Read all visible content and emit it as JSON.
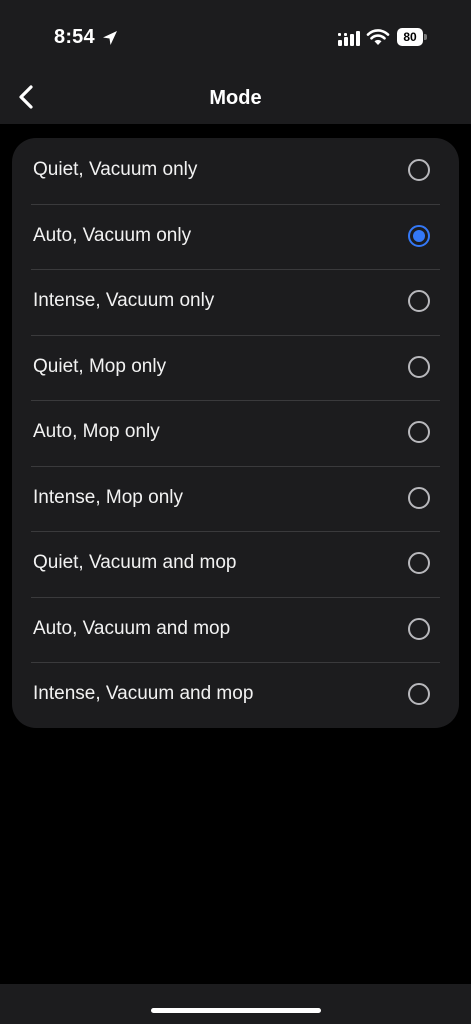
{
  "status_bar": {
    "time": "8:54",
    "battery": "80",
    "location_icon": "location-arrow-icon",
    "signal_icon": "cellular-signal-icon",
    "wifi_icon": "wifi-icon"
  },
  "nav": {
    "title": "Mode",
    "back_icon": "chevron-left-icon"
  },
  "modes": {
    "selected_index": 1,
    "accent_color": "#3478f6",
    "options": [
      {
        "label": "Quiet, Vacuum only",
        "selected": false
      },
      {
        "label": "Auto, Vacuum only",
        "selected": true
      },
      {
        "label": "Intense, Vacuum only",
        "selected": false
      },
      {
        "label": "Quiet, Mop only",
        "selected": false
      },
      {
        "label": "Auto, Mop only",
        "selected": false
      },
      {
        "label": "Intense, Mop only",
        "selected": false
      },
      {
        "label": "Quiet, Vacuum and mop",
        "selected": false
      },
      {
        "label": "Auto, Vacuum and mop",
        "selected": false
      },
      {
        "label": "Intense, Vacuum and mop",
        "selected": false
      }
    ]
  }
}
